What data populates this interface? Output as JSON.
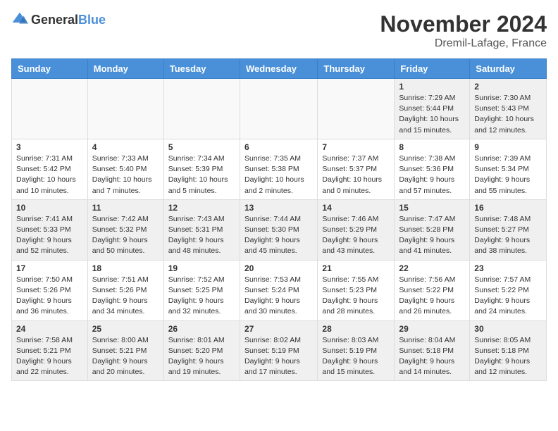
{
  "logo": {
    "text_general": "General",
    "text_blue": "Blue"
  },
  "title": {
    "month": "November 2024",
    "location": "Dremil-Lafage, France"
  },
  "headers": [
    "Sunday",
    "Monday",
    "Tuesday",
    "Wednesday",
    "Thursday",
    "Friday",
    "Saturday"
  ],
  "weeks": [
    [
      {
        "day": "",
        "info": ""
      },
      {
        "day": "",
        "info": ""
      },
      {
        "day": "",
        "info": ""
      },
      {
        "day": "",
        "info": ""
      },
      {
        "day": "",
        "info": ""
      },
      {
        "day": "1",
        "info": "Sunrise: 7:29 AM\nSunset: 5:44 PM\nDaylight: 10 hours and 15 minutes."
      },
      {
        "day": "2",
        "info": "Sunrise: 7:30 AM\nSunset: 5:43 PM\nDaylight: 10 hours and 12 minutes."
      }
    ],
    [
      {
        "day": "3",
        "info": "Sunrise: 7:31 AM\nSunset: 5:42 PM\nDaylight: 10 hours and 10 minutes."
      },
      {
        "day": "4",
        "info": "Sunrise: 7:33 AM\nSunset: 5:40 PM\nDaylight: 10 hours and 7 minutes."
      },
      {
        "day": "5",
        "info": "Sunrise: 7:34 AM\nSunset: 5:39 PM\nDaylight: 10 hours and 5 minutes."
      },
      {
        "day": "6",
        "info": "Sunrise: 7:35 AM\nSunset: 5:38 PM\nDaylight: 10 hours and 2 minutes."
      },
      {
        "day": "7",
        "info": "Sunrise: 7:37 AM\nSunset: 5:37 PM\nDaylight: 10 hours and 0 minutes."
      },
      {
        "day": "8",
        "info": "Sunrise: 7:38 AM\nSunset: 5:36 PM\nDaylight: 9 hours and 57 minutes."
      },
      {
        "day": "9",
        "info": "Sunrise: 7:39 AM\nSunset: 5:34 PM\nDaylight: 9 hours and 55 minutes."
      }
    ],
    [
      {
        "day": "10",
        "info": "Sunrise: 7:41 AM\nSunset: 5:33 PM\nDaylight: 9 hours and 52 minutes."
      },
      {
        "day": "11",
        "info": "Sunrise: 7:42 AM\nSunset: 5:32 PM\nDaylight: 9 hours and 50 minutes."
      },
      {
        "day": "12",
        "info": "Sunrise: 7:43 AM\nSunset: 5:31 PM\nDaylight: 9 hours and 48 minutes."
      },
      {
        "day": "13",
        "info": "Sunrise: 7:44 AM\nSunset: 5:30 PM\nDaylight: 9 hours and 45 minutes."
      },
      {
        "day": "14",
        "info": "Sunrise: 7:46 AM\nSunset: 5:29 PM\nDaylight: 9 hours and 43 minutes."
      },
      {
        "day": "15",
        "info": "Sunrise: 7:47 AM\nSunset: 5:28 PM\nDaylight: 9 hours and 41 minutes."
      },
      {
        "day": "16",
        "info": "Sunrise: 7:48 AM\nSunset: 5:27 PM\nDaylight: 9 hours and 38 minutes."
      }
    ],
    [
      {
        "day": "17",
        "info": "Sunrise: 7:50 AM\nSunset: 5:26 PM\nDaylight: 9 hours and 36 minutes."
      },
      {
        "day": "18",
        "info": "Sunrise: 7:51 AM\nSunset: 5:26 PM\nDaylight: 9 hours and 34 minutes."
      },
      {
        "day": "19",
        "info": "Sunrise: 7:52 AM\nSunset: 5:25 PM\nDaylight: 9 hours and 32 minutes."
      },
      {
        "day": "20",
        "info": "Sunrise: 7:53 AM\nSunset: 5:24 PM\nDaylight: 9 hours and 30 minutes."
      },
      {
        "day": "21",
        "info": "Sunrise: 7:55 AM\nSunset: 5:23 PM\nDaylight: 9 hours and 28 minutes."
      },
      {
        "day": "22",
        "info": "Sunrise: 7:56 AM\nSunset: 5:22 PM\nDaylight: 9 hours and 26 minutes."
      },
      {
        "day": "23",
        "info": "Sunrise: 7:57 AM\nSunset: 5:22 PM\nDaylight: 9 hours and 24 minutes."
      }
    ],
    [
      {
        "day": "24",
        "info": "Sunrise: 7:58 AM\nSunset: 5:21 PM\nDaylight: 9 hours and 22 minutes."
      },
      {
        "day": "25",
        "info": "Sunrise: 8:00 AM\nSunset: 5:21 PM\nDaylight: 9 hours and 20 minutes."
      },
      {
        "day": "26",
        "info": "Sunrise: 8:01 AM\nSunset: 5:20 PM\nDaylight: 9 hours and 19 minutes."
      },
      {
        "day": "27",
        "info": "Sunrise: 8:02 AM\nSunset: 5:19 PM\nDaylight: 9 hours and 17 minutes."
      },
      {
        "day": "28",
        "info": "Sunrise: 8:03 AM\nSunset: 5:19 PM\nDaylight: 9 hours and 15 minutes."
      },
      {
        "day": "29",
        "info": "Sunrise: 8:04 AM\nSunset: 5:18 PM\nDaylight: 9 hours and 14 minutes."
      },
      {
        "day": "30",
        "info": "Sunrise: 8:05 AM\nSunset: 5:18 PM\nDaylight: 9 hours and 12 minutes."
      }
    ]
  ]
}
